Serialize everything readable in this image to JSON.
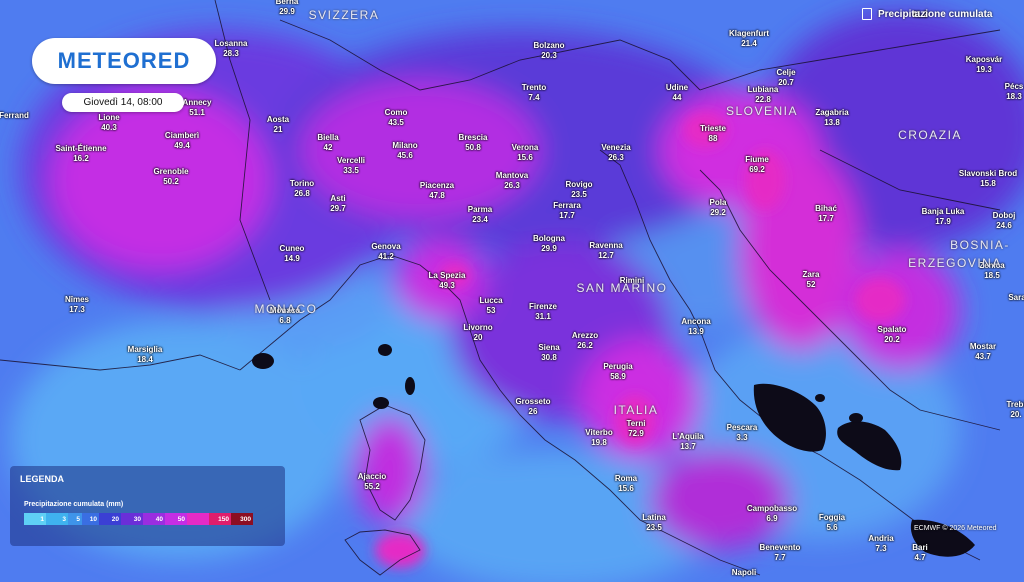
{
  "brand": {
    "name": "METEORED",
    "color": "#1f6fd1"
  },
  "datetime": "Giovedì 14, 08:00",
  "layer_title": "Precipitazione cumulata",
  "credit": "ECMWF © 2026 Meteored",
  "legend": {
    "title": "LEGENDA",
    "subtitle": "Precipitazione cumulata (mm)",
    "steps": [
      {
        "label": "1",
        "color": "#5fd0f5"
      },
      {
        "label": "3",
        "color": "#3fb2ef"
      },
      {
        "label": "5",
        "color": "#3e94ea"
      },
      {
        "label": "10",
        "color": "#3a6ee2"
      },
      {
        "label": "20",
        "color": "#3b3fd4"
      },
      {
        "label": "30",
        "color": "#6a2fd8"
      },
      {
        "label": "40",
        "color": "#9a2ee0"
      },
      {
        "label": "50",
        "color": "#c42ee4"
      },
      {
        "label": "",
        "color": "#e52bc6"
      },
      {
        "label": "150",
        "color": "#e01e6c"
      },
      {
        "label": "300",
        "color": "#8c0e22"
      }
    ]
  },
  "regions": [
    {
      "id": "svizzera",
      "label": "SVIZZERA"
    },
    {
      "id": "slovenia",
      "label": "SLOVENIA"
    },
    {
      "id": "croazia",
      "label": "CROAZIA"
    },
    {
      "id": "bosnia",
      "label": "BOSNIA-"
    },
    {
      "id": "erzegovina",
      "label": "ERZEGOVINA"
    },
    {
      "id": "sanmarino",
      "label": "SAN MARINO"
    },
    {
      "id": "italia",
      "label": "ITALIA"
    },
    {
      "id": "monaco",
      "label": "MONACO"
    }
  ],
  "cities": [
    {
      "name": "Berna",
      "value": "29.9"
    },
    {
      "name": "",
      "value": "41.2"
    },
    {
      "name": "Losanna",
      "value": "28.3"
    },
    {
      "name": "Bolzano",
      "value": "20.3"
    },
    {
      "name": "Klagenfurt",
      "value": "21.4"
    },
    {
      "name": "Kaposvár",
      "value": "19.3"
    },
    {
      "name": "Celje",
      "value": "20.7"
    },
    {
      "name": "Pécs",
      "value": "18.3"
    },
    {
      "name": "Trento",
      "value": "7.4"
    },
    {
      "name": "Udine",
      "value": "44"
    },
    {
      "name": "Lubiana",
      "value": "22.8"
    },
    {
      "name": "Zagabria",
      "value": "13.8"
    },
    {
      "name": "Annecy",
      "value": "51.1"
    },
    {
      "name": "Lione",
      "value": "40.3"
    },
    {
      "name": "Ferrand",
      "value": ""
    },
    {
      "name": "Aosta",
      "value": "21"
    },
    {
      "name": "Como",
      "value": "43.5"
    },
    {
      "name": "Trieste",
      "value": "88"
    },
    {
      "name": "Ciamberì",
      "value": "49.4"
    },
    {
      "name": "Biella",
      "value": "42"
    },
    {
      "name": "Brescia",
      "value": "50.8"
    },
    {
      "name": "Milano",
      "value": "45.6"
    },
    {
      "name": "Verona",
      "value": "15.6"
    },
    {
      "name": "Venezia",
      "value": "26.3"
    },
    {
      "name": "Saint-Étienne",
      "value": "16.2"
    },
    {
      "name": "Vercelli",
      "value": "33.5"
    },
    {
      "name": "Fiume",
      "value": "69.2"
    },
    {
      "name": "Slavonski Brod",
      "value": "15.8"
    },
    {
      "name": "Grenoble",
      "value": "50.2"
    },
    {
      "name": "Mantova",
      "value": "26.3"
    },
    {
      "name": "Torino",
      "value": "26.8"
    },
    {
      "name": "Piacenza",
      "value": "47.8"
    },
    {
      "name": "Rovigo",
      "value": "23.5"
    },
    {
      "name": "Asti",
      "value": "29.7"
    },
    {
      "name": "Ferrara",
      "value": "17.7"
    },
    {
      "name": "Pola",
      "value": "29.2"
    },
    {
      "name": "Parma",
      "value": "23.4"
    },
    {
      "name": "Bihać",
      "value": "17.7"
    },
    {
      "name": "Banja Luka",
      "value": "17.9"
    },
    {
      "name": "Doboj",
      "value": "24.6"
    },
    {
      "name": "Bologna",
      "value": "29.9"
    },
    {
      "name": "Genova",
      "value": "41.2"
    },
    {
      "name": "Cuneo",
      "value": "14.9"
    },
    {
      "name": "Ravenna",
      "value": "12.7"
    },
    {
      "name": "Zenica",
      "value": "18.5"
    },
    {
      "name": "La Spezia",
      "value": "49.3"
    },
    {
      "name": "Rimini",
      "value": ""
    },
    {
      "name": "Zara",
      "value": "52"
    },
    {
      "name": "Nîmes",
      "value": "17.3"
    },
    {
      "name": "Lucca",
      "value": "53"
    },
    {
      "name": "Sara",
      "value": ""
    },
    {
      "name": "Firenze",
      "value": "31.1"
    },
    {
      "name": "Monaco",
      "value": "6.8"
    },
    {
      "name": "Ancona",
      "value": "13.9"
    },
    {
      "name": "Livorno",
      "value": "20"
    },
    {
      "name": "Spalato",
      "value": "20.2"
    },
    {
      "name": "Arezzo",
      "value": "26.2"
    },
    {
      "name": "Marsiglia",
      "value": "18.4"
    },
    {
      "name": "Siena",
      "value": "30.8"
    },
    {
      "name": "Mostar",
      "value": "43.7"
    },
    {
      "name": "Perugia",
      "value": "58.9"
    },
    {
      "name": "Grosseto",
      "value": "26"
    },
    {
      "name": "Trebi",
      "value": "20."
    },
    {
      "name": "Terni",
      "value": "72.9"
    },
    {
      "name": "Pescara",
      "value": "3.3"
    },
    {
      "name": "Viterbo",
      "value": "19.8"
    },
    {
      "name": "L'Aquila",
      "value": "13.7"
    },
    {
      "name": "Ajaccio",
      "value": "55.2"
    },
    {
      "name": "Roma",
      "value": "15.6"
    },
    {
      "name": "Campobasso",
      "value": "6.9"
    },
    {
      "name": "Latina",
      "value": "23.5"
    },
    {
      "name": "Foggia",
      "value": "5.6"
    },
    {
      "name": "Andria",
      "value": "7.3"
    },
    {
      "name": "Bari",
      "value": "4.7"
    },
    {
      "name": "Benevento",
      "value": "7.7"
    },
    {
      "name": "Napoli",
      "value": ""
    }
  ]
}
